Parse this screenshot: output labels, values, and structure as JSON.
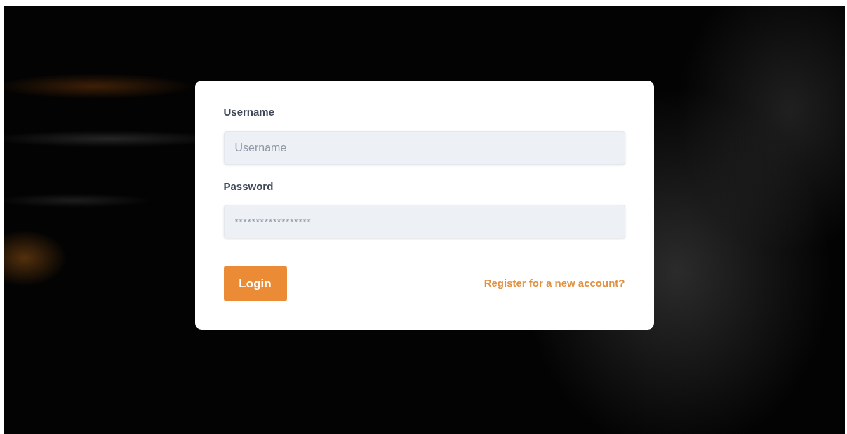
{
  "login_form": {
    "fields": [
      {
        "label": "Username",
        "placeholder": "Username",
        "kind": "text"
      },
      {
        "label": "Password",
        "placeholder": "******************",
        "kind": "password"
      }
    ],
    "submit_button": {
      "label": "Login"
    },
    "register_link": {
      "label": "Register for a new account?"
    }
  }
}
